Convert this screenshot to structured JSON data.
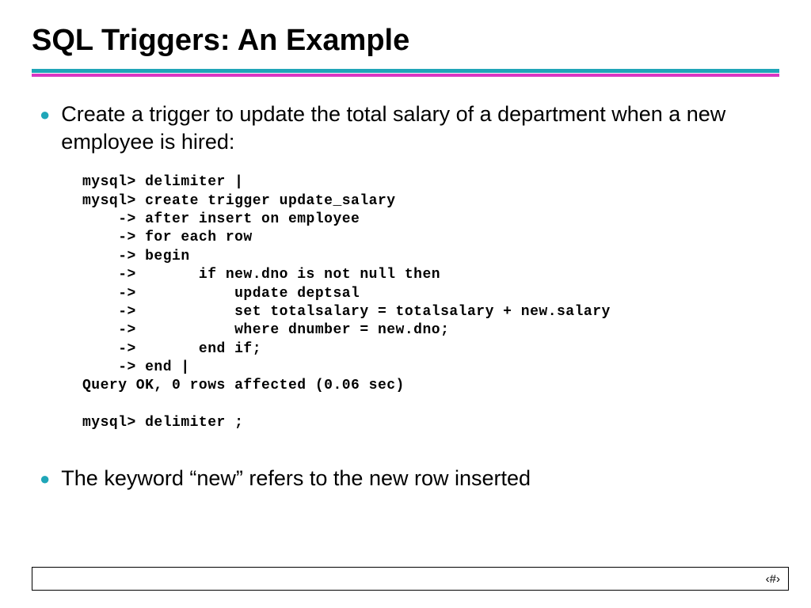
{
  "title": "SQL Triggers: An Example",
  "bullets": {
    "item1": "Create a trigger to update the total salary of a department when a new employee is hired:",
    "item2": "The keyword “new” refers to the new row inserted"
  },
  "code": "mysql> delimiter |\nmysql> create trigger update_salary\n    -> after insert on employee\n    -> for each row\n    -> begin\n    ->       if new.dno is not null then\n    ->           update deptsal\n    ->           set totalsalary = totalsalary + new.salary\n    ->           where dnumber = new.dno;\n    ->       end if;\n    -> end |\nQuery OK, 0 rows affected (0.06 sec)\n\nmysql> delimiter ;",
  "footer": {
    "pagenum": "‹#›"
  }
}
